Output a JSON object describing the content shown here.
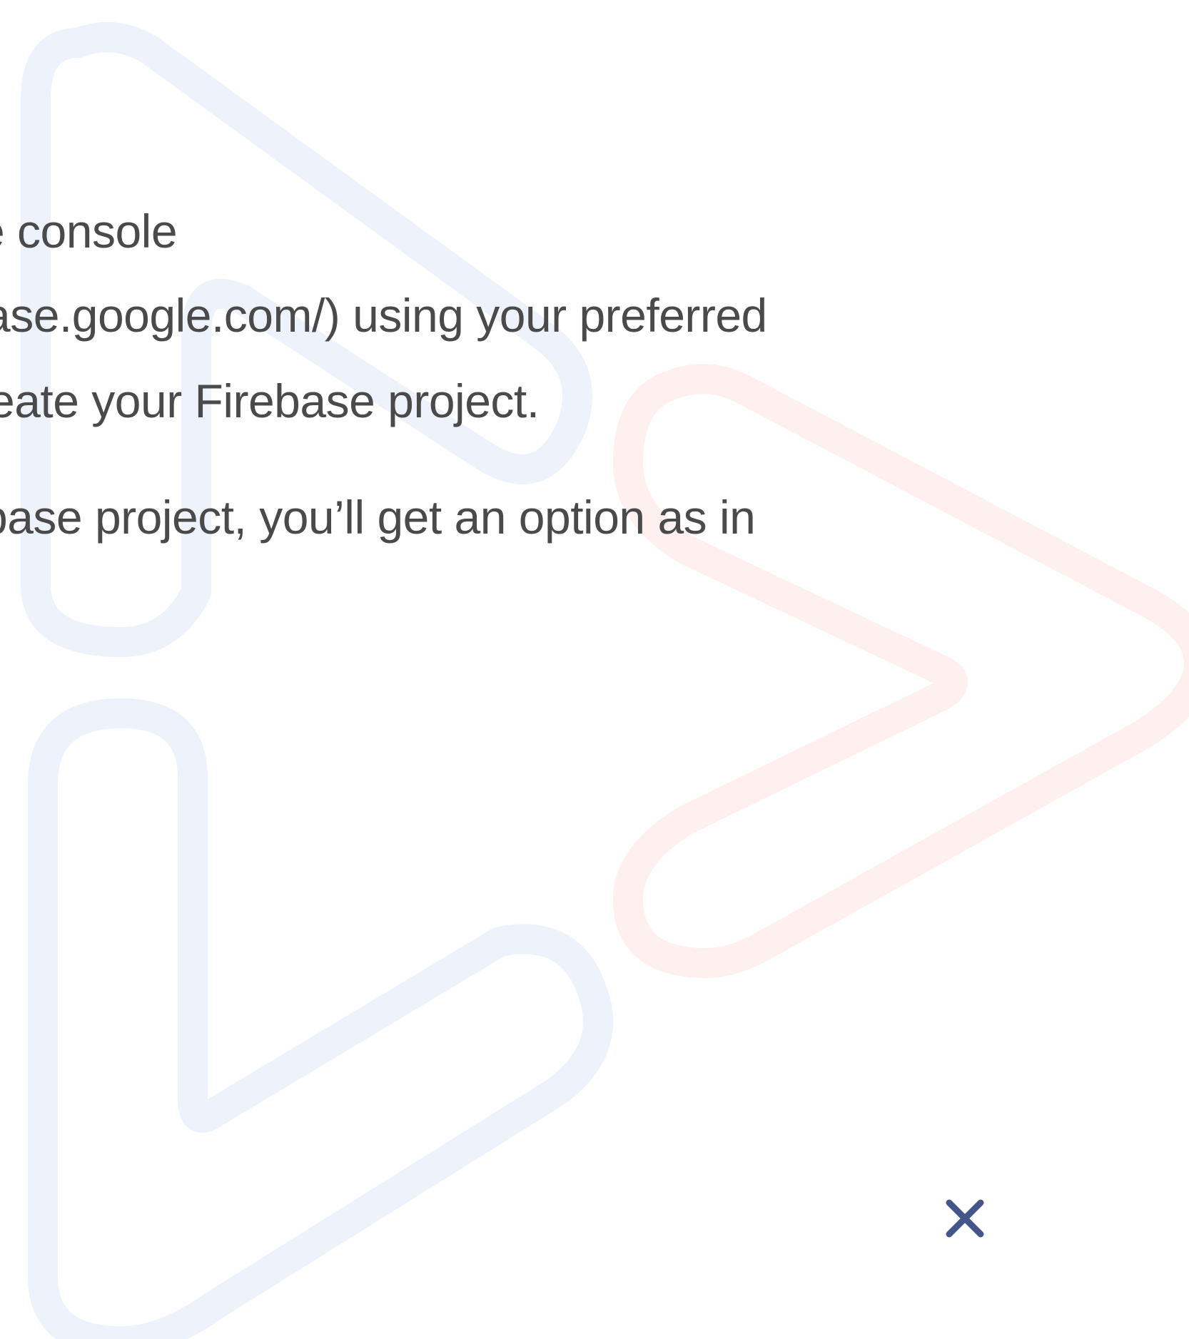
{
  "content": {
    "lines": [
      "e console",
      "ase.google.com/) using your preferred",
      "eate your Firebase project.",
      "base project, you’ll get an option as in"
    ]
  },
  "icons": {
    "close": "close-icon",
    "watermark": "brand-watermark-icon"
  },
  "colors": {
    "text": "#4a4a4a",
    "close_icon": "#44568a",
    "watermark_blue": "#eef2fa",
    "watermark_red": "#fdf0ee",
    "background": "#ffffff"
  }
}
